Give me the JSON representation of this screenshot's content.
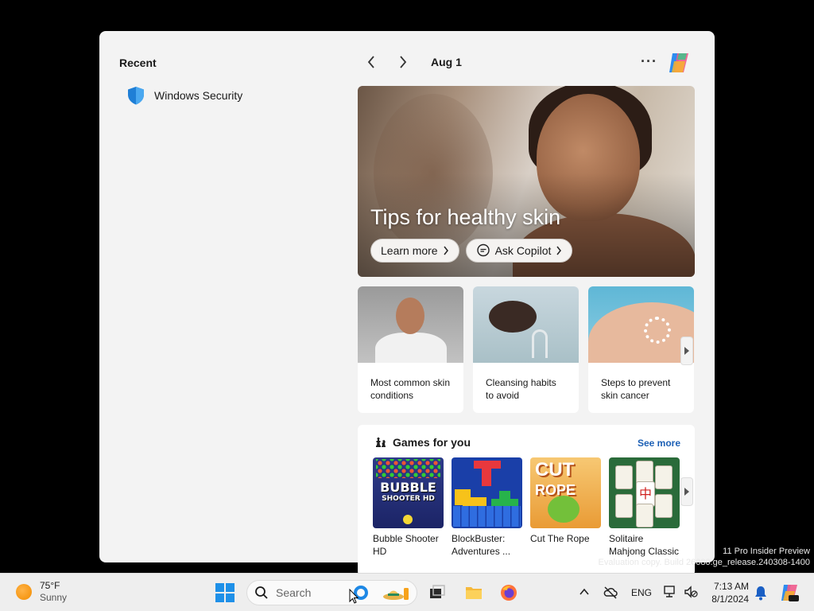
{
  "panel": {
    "recent": {
      "title": "Recent",
      "items": [
        {
          "label": "Windows Security",
          "icon": "shield-icon"
        }
      ]
    },
    "nav": {
      "date": "Aug 1",
      "more": "···"
    },
    "hero": {
      "title": "Tips for healthy skin",
      "learn_more": "Learn more",
      "ask_copilot": "Ask Copilot"
    },
    "cards": [
      {
        "caption": "Most common skin conditions"
      },
      {
        "caption": "Cleansing habits to avoid"
      },
      {
        "caption": "Steps to prevent skin cancer"
      }
    ],
    "games": {
      "title": "Games for you",
      "see_more": "See more",
      "items": [
        {
          "name": "Bubble Shooter HD",
          "tile_word": "BUBBLE",
          "tile_word2": "SHOOTER HD"
        },
        {
          "name": "BlockBuster: Adventures ..."
        },
        {
          "name": "Cut The Rope",
          "tile_word": "CUT",
          "tile_word2": "ROPE"
        },
        {
          "name": "Solitaire Mahjong Classic",
          "tile_glyph": "中"
        }
      ]
    }
  },
  "watermark": {
    "line1": "11 Pro Insider Preview",
    "line2": "Evaluation copy. Build 26080.ge_release.240308-1400"
  },
  "taskbar": {
    "weather": {
      "temp": "75°F",
      "condition": "Sunny"
    },
    "search_placeholder": "Search",
    "language": "ENG",
    "time": "7:13 AM",
    "date": "8/1/2024"
  },
  "colors": {
    "accent": "#1e90e8",
    "link": "#1b5fb5"
  }
}
